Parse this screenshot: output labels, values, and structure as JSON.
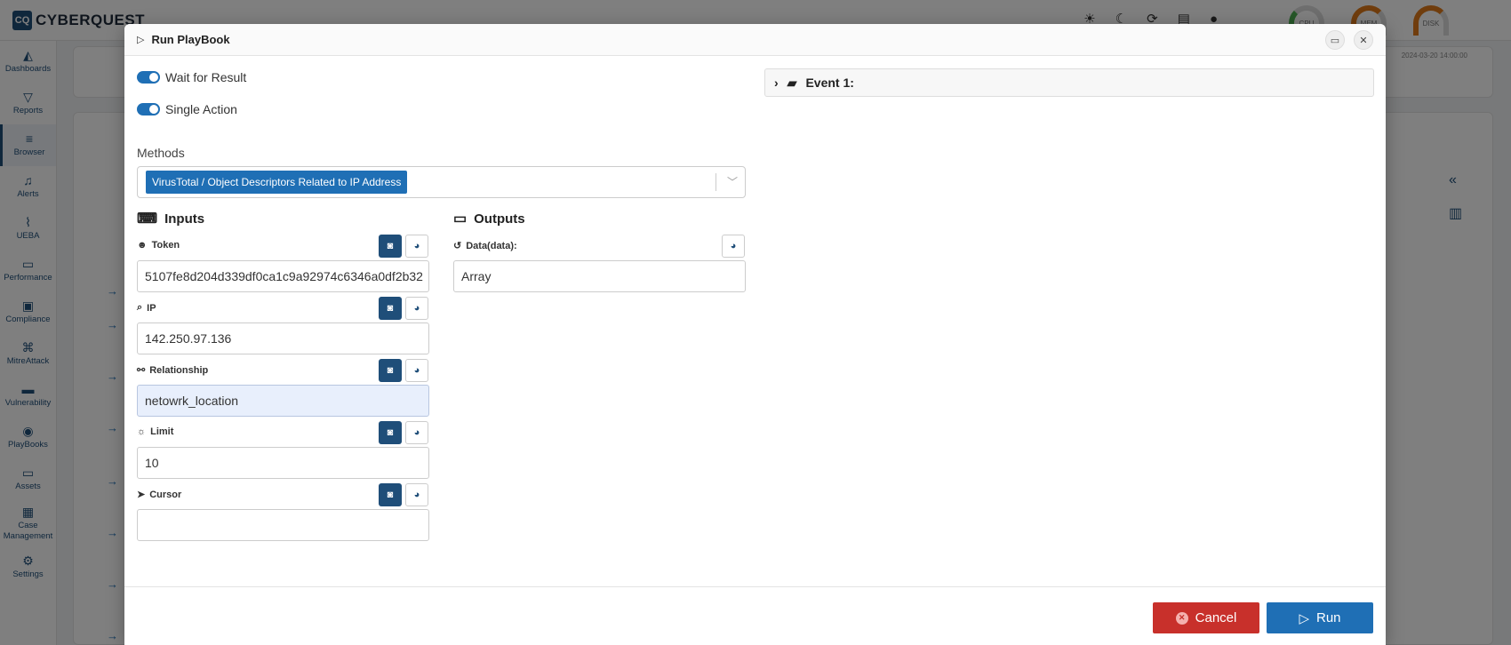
{
  "app": {
    "logo_mark": "CQ",
    "logo_text": "CYBERQUEST",
    "gauges": [
      {
        "label": "CPU"
      },
      {
        "label": "MEM",
        "min": "0",
        "max": "100"
      },
      {
        "label": "DISK",
        "min": "0",
        "max": "100"
      }
    ],
    "timestamp": "2024-03-20 14:00:00"
  },
  "sidebar": {
    "items": [
      {
        "label": "Dashboards",
        "icon": "chart-icon"
      },
      {
        "label": "Reports",
        "icon": "filter-icon"
      },
      {
        "label": "Browser",
        "icon": "list-icon"
      },
      {
        "label": "Alerts",
        "icon": "bell-icon"
      },
      {
        "label": "UEBA",
        "icon": "graph-icon"
      },
      {
        "label": "Performance",
        "icon": "keyboard-icon"
      },
      {
        "label": "Compliance",
        "icon": "compliance-icon"
      },
      {
        "label": "MitreAttack",
        "icon": "command-icon"
      },
      {
        "label": "Vulnerability",
        "icon": "toggle-icon"
      },
      {
        "label": "PlayBooks",
        "icon": "playbook-icon"
      },
      {
        "label": "Assets",
        "icon": "laptop-icon"
      },
      {
        "label": "Case Management",
        "icon": "briefcase-icon"
      },
      {
        "label": "Settings",
        "icon": "gear-icon"
      }
    ]
  },
  "modal": {
    "title": "Run PlayBook",
    "wait_for_result": "Wait for Result",
    "single_action": "Single Action",
    "methods_label": "Methods",
    "method_selected": "VirusTotal / Object Descriptors Related to IP Address",
    "inputs_title": "Inputs",
    "outputs_title": "Outputs",
    "fields": [
      {
        "label": "Token",
        "value": "5107fe8d204d339df0ca1c9a92974c6346a0df2b32",
        "icon": "user-icon"
      },
      {
        "label": "IP",
        "value": "142.250.97.136",
        "icon": "search-icon"
      },
      {
        "label": "Relationship",
        "value": "netowrk_location",
        "icon": "handshake-icon"
      },
      {
        "label": "Limit",
        "value": "10",
        "icon": "sun-icon"
      },
      {
        "label": "Cursor",
        "value": "",
        "icon": "cursor-icon"
      }
    ],
    "output_field": {
      "label": "Data(data):",
      "value": "Array"
    },
    "event_label": "Event 1:",
    "cancel_label": "Cancel",
    "run_label": "Run"
  }
}
